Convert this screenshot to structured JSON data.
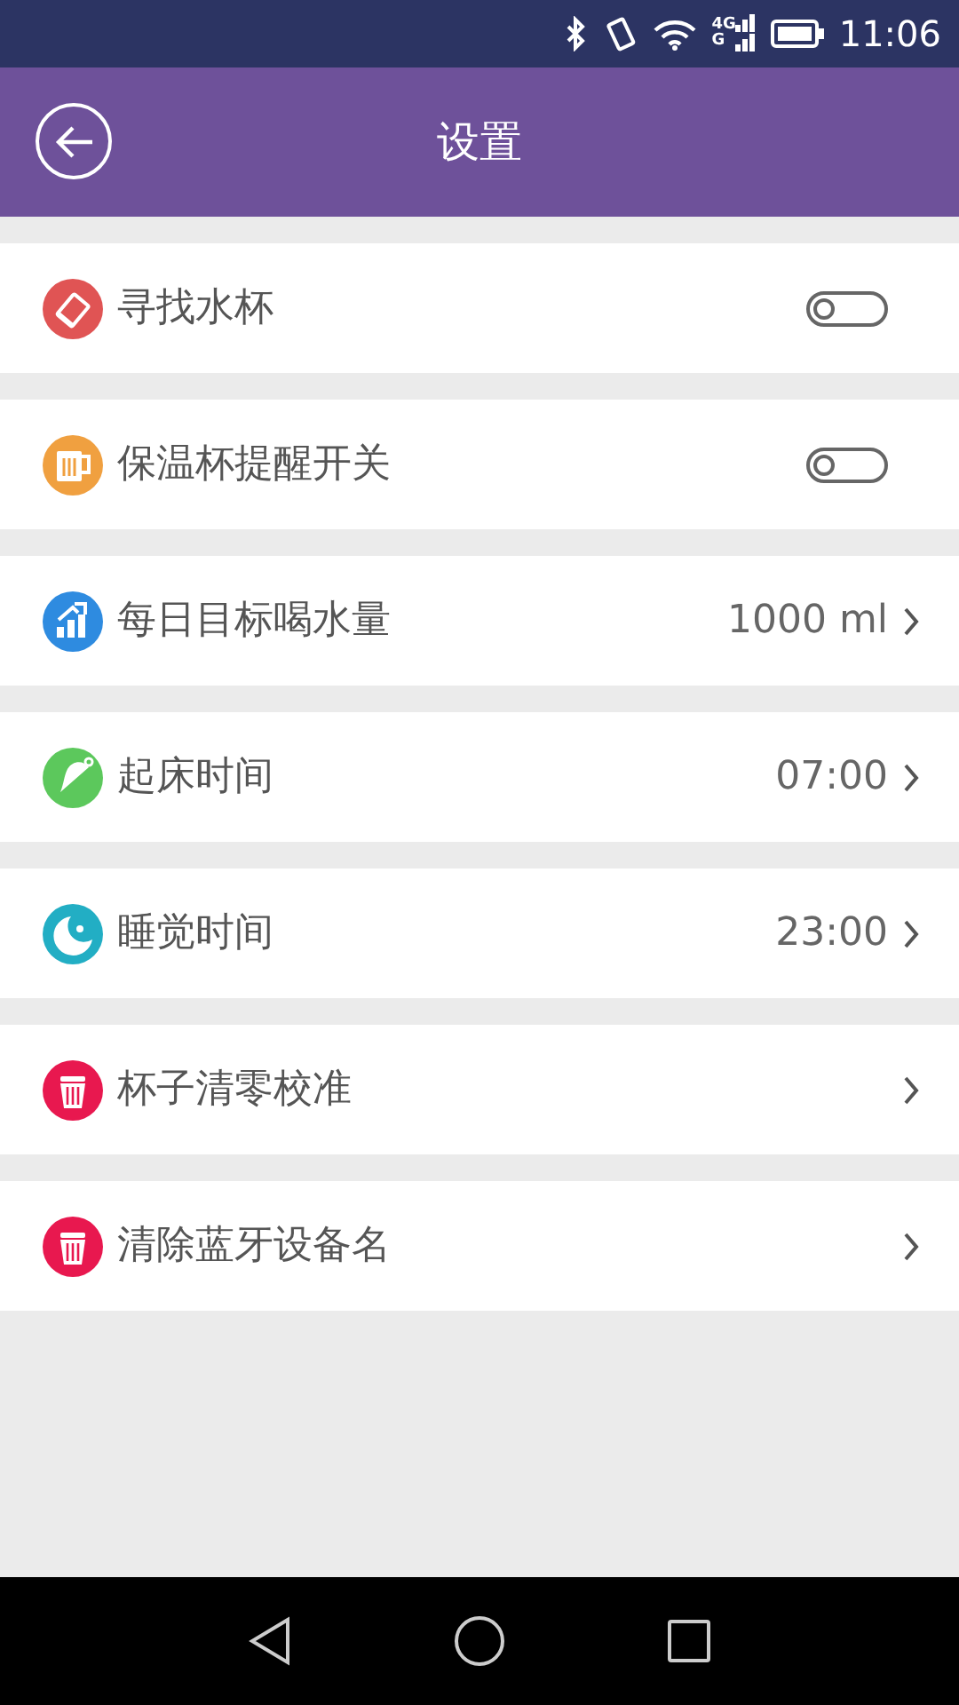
{
  "status_bar": {
    "network_top": "4G",
    "network_bottom": "G",
    "time": "11:06"
  },
  "header": {
    "title": "设置"
  },
  "settings": [
    {
      "kind": "toggle",
      "color": "#e05454",
      "label": "寻找水杯",
      "on": false
    },
    {
      "kind": "toggle",
      "color": "#f0a040",
      "label": "保温杯提醒开关",
      "on": false
    },
    {
      "kind": "link",
      "color": "#2e8be0",
      "label": "每日目标喝水量",
      "value": "1000 ml"
    },
    {
      "kind": "link",
      "color": "#5cc85c",
      "label": "起床时间",
      "value": "07:00"
    },
    {
      "kind": "link",
      "color": "#22aec4",
      "label": "睡觉时间",
      "value": "23:00"
    },
    {
      "kind": "link",
      "color": "#e8184f",
      "label": "杯子清零校准"
    },
    {
      "kind": "link",
      "color": "#e8184f",
      "label": "清除蓝牙设备名"
    }
  ]
}
